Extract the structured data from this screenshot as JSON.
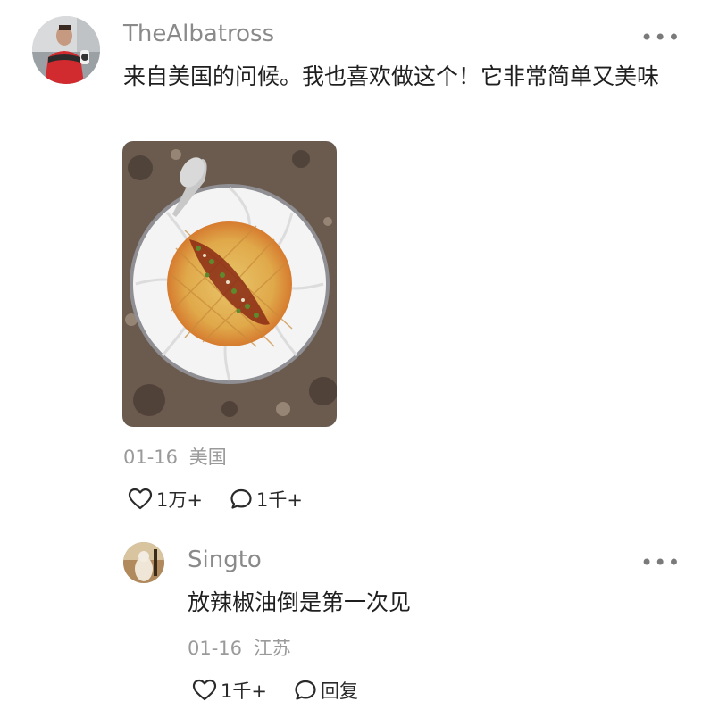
{
  "comments": [
    {
      "username": "TheAlbatross",
      "text": "来自美国的问候。我也喜欢做这个！它非常简单又美味",
      "date": "01-16",
      "location": "美国",
      "likes": "1万+",
      "replies": "1千+",
      "more_icon": "more-dots-icon",
      "like_icon": "heart-outline-icon",
      "comment_icon": "speech-bubble-icon"
    }
  ],
  "reply": {
    "username": "Singto",
    "text": "放辣椒油倒是第一次见",
    "date": "01-16",
    "location": "江苏",
    "likes": "1千+",
    "reply_label": "回复",
    "more_icon": "more-dots-icon",
    "like_icon": "heart-outline-icon",
    "comment_icon": "speech-bubble-icon"
  },
  "colors": {
    "username": "#8a8a8a",
    "meta": "#9a9a9a",
    "text": "#1f1f1f"
  }
}
